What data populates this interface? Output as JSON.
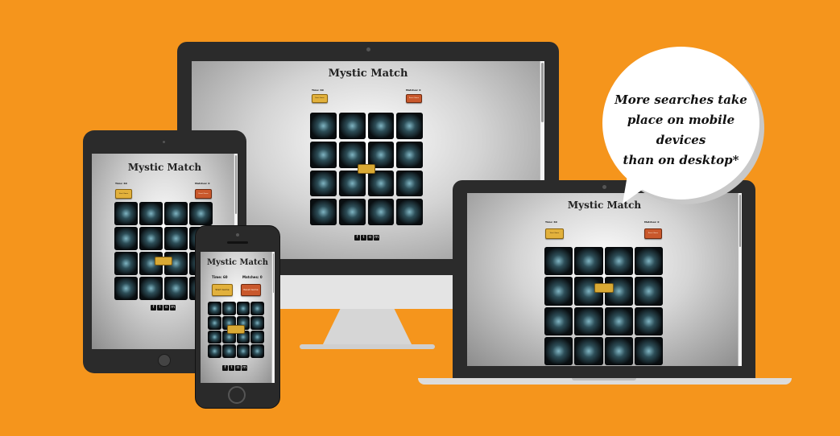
{
  "app": {
    "title": "Mystic Match",
    "time_label": "Time: 60",
    "matches_label": "Matches: 0",
    "start_label": "Start Game",
    "reset_label": "Reset Game",
    "overlay_label": "",
    "card_count": 16
  },
  "socials": {
    "facebook": "f",
    "twitter": "t",
    "instagram": "o",
    "email": "m"
  },
  "bubble": {
    "line1": "More searches take",
    "line2": "place on mobile devices",
    "line3": "than on desktop*"
  },
  "colors": {
    "background": "#f5951c",
    "device_frame": "#2b2b2b",
    "start_button": "#e2b13c",
    "reset_button": "#c9582c"
  },
  "icons": [
    "facebook-icon",
    "twitter-icon",
    "instagram-icon",
    "email-icon"
  ]
}
